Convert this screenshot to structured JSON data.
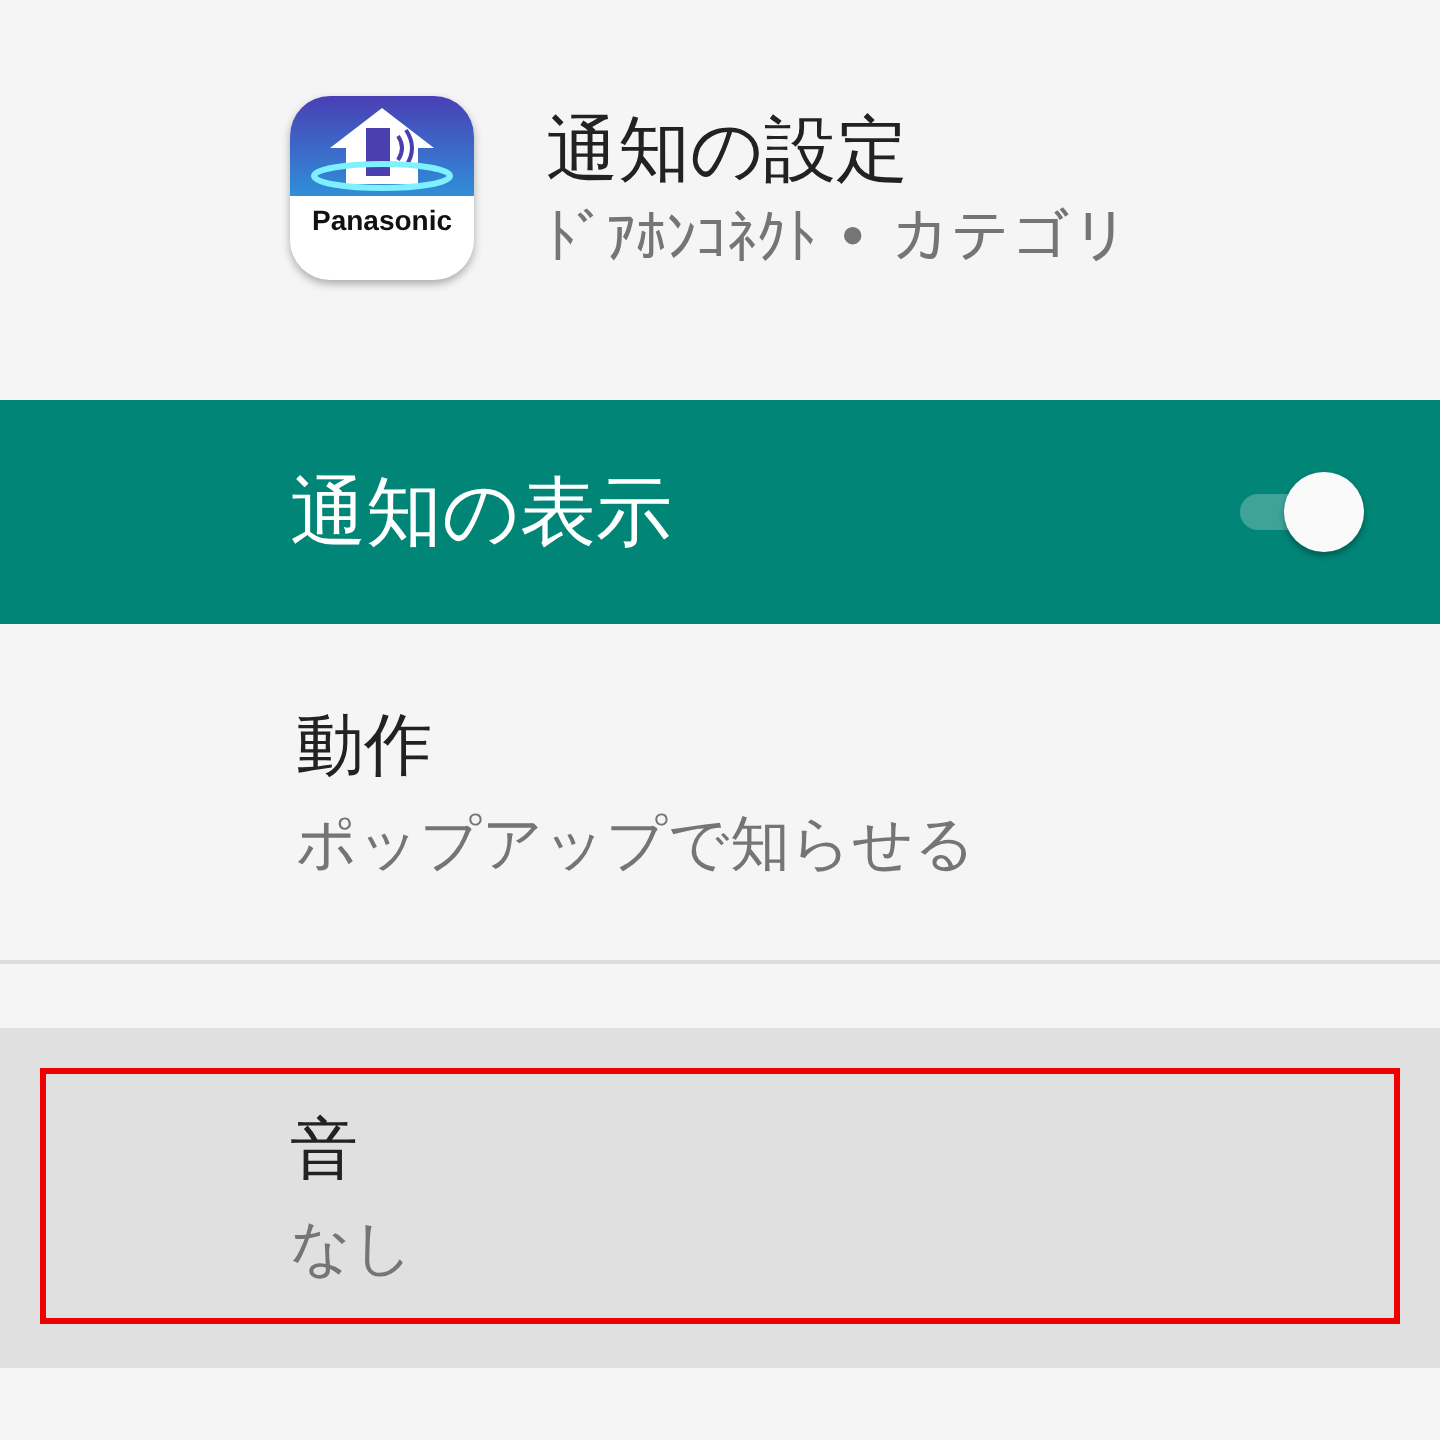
{
  "header": {
    "app_icon_label": "Panasonic",
    "title": "通知の設定",
    "subtitle": "ﾄﾞｱﾎﾝｺﾈｸﾄ • カテゴリ"
  },
  "master_switch": {
    "label": "通知の表示",
    "on": true
  },
  "settings": [
    {
      "title": "動作",
      "value": "ポップアップで知らせる",
      "selected": false,
      "outlined": false
    },
    {
      "title": "音",
      "value": "なし",
      "selected": true,
      "outlined": true
    }
  ]
}
